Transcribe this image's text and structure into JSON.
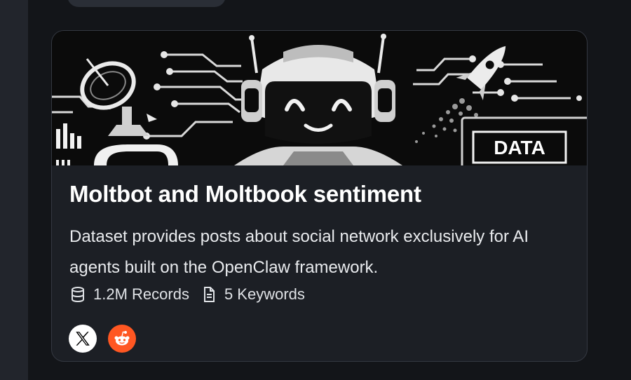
{
  "card": {
    "banner_badge": "DATA",
    "title": "Moltbot and Moltbook sentiment",
    "description": "Dataset provides posts about social network exclusively for AI agents built on the OpenClaw framework.",
    "records": "1.2M Records",
    "keywords": "5 Keywords",
    "sources": [
      {
        "name": "x-icon"
      },
      {
        "name": "reddit-icon"
      }
    ]
  },
  "colors": {
    "background": "#131519",
    "card": "#1c1f25",
    "reddit": "#ff5722"
  }
}
